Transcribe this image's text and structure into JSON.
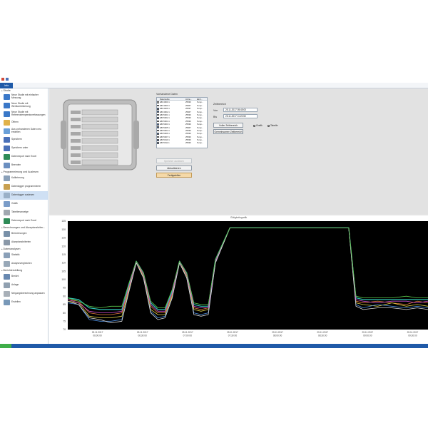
{
  "tab": {
    "label": "Info"
  },
  "sidebar": {
    "sections": [
      {
        "title": "Studie",
        "items": [
          {
            "label": "Neue Studie mit einfacher Messung",
            "icon": "new-study-icon"
          },
          {
            "label": "Neue Studie mit Wertkombinierung",
            "icon": "new-study-icon"
          },
          {
            "label": "Neue Studie mit Referenztemperaturerfassungen",
            "icon": "new-study-icon"
          },
          {
            "label": "Öffnen",
            "icon": "open-folder-icon"
          },
          {
            "label": "Aus vorhandenen Daten neu erstellen",
            "icon": "create-icon"
          },
          {
            "label": "Speichern",
            "icon": "save-icon"
          },
          {
            "label": "Speichern unter",
            "icon": "save-as-icon"
          },
          {
            "label": "Datenexport nach Excel",
            "icon": "excel-icon"
          },
          {
            "label": "Beenden",
            "icon": "exit-icon"
          }
        ]
      },
      {
        "title": "Programmierung und Auslesen",
        "items": [
          {
            "label": "Kalibrierung",
            "icon": "calibration-icon"
          },
          {
            "label": "Datenlogger programmieren",
            "icon": "logger-program-icon"
          },
          {
            "label": "Datenlogger auslesen",
            "icon": "logger-read-icon",
            "selected": true
          }
        ]
      },
      {
        "title": "",
        "items": [
          {
            "label": "Grafik",
            "icon": "graph-icon"
          },
          {
            "label": "Tabellenanzeige",
            "icon": "table-icon"
          },
          {
            "label": "Datenexport nach Excel",
            "icon": "excel-icon"
          }
        ]
      },
      {
        "title": "Berechnungen und Akzeptanzkriter...",
        "items": [
          {
            "label": "Berechnungen",
            "icon": "calc-icon"
          },
          {
            "label": "Akzeptanzkriterien",
            "icon": "criteria-icon"
          }
        ]
      },
      {
        "title": "Datenanalysen",
        "items": [
          {
            "label": "Statistik",
            "icon": "stats-icon"
          },
          {
            "label": "Analysevergleichen",
            "icon": "analysis-icon"
          }
        ]
      },
      {
        "title": "Berichterstellung",
        "items": [
          {
            "label": "Bericht",
            "icon": "report-icon"
          },
          {
            "label": "Anlage",
            "icon": "attachment-icon"
          },
          {
            "label": "Neigungsberechnung anpassen",
            "icon": "slope-icon"
          },
          {
            "label": "Erstellen",
            "icon": "create-report-icon"
          }
        ]
      }
    ]
  },
  "data_panel": {
    "title": "Vorhandene Daten",
    "columns": [
      "Datenreihe",
      "Anza...",
      "Einh..."
    ],
    "rows": [
      {
        "name": "EBI 4600 1",
        "count": "25536",
        "unit": "Temp...",
        "checked": false
      },
      {
        "name": "EBI 4600 1",
        "count": "25667",
        "unit": "Temp...",
        "checked": false
      },
      {
        "name": "EBI 4626 1",
        "count": "25537",
        "unit": "Temp...",
        "checked": true
      },
      {
        "name": "EBI 4602 1",
        "count": "25667",
        "unit": "Temp...",
        "checked": true
      },
      {
        "name": "EBI 5001 1",
        "count": "25530",
        "unit": "Temp...",
        "checked": true
      },
      {
        "name": "EBI 5002 1",
        "count": "25536",
        "unit": "Temp...",
        "checked": true
      },
      {
        "name": "EBI 5004 1",
        "count": "25530",
        "unit": "Temp...",
        "checked": true
      },
      {
        "name": "EBI 5003 1",
        "count": "25536",
        "unit": "Temp...",
        "checked": true
      },
      {
        "name": "EBI 5005 1",
        "count": "25667",
        "unit": "Temp...",
        "checked": true
      },
      {
        "name": "EBI 5004 1",
        "count": "25536",
        "unit": "Temp...",
        "checked": true
      },
      {
        "name": "EBI 5006 1",
        "count": "25536",
        "unit": "Temp...",
        "checked": true
      },
      {
        "name": "EBI 5007 1",
        "count": "25536",
        "unit": "Temp...",
        "checked": true
      },
      {
        "name": "EBI 5010 1",
        "count": "25536",
        "unit": "Temp...",
        "checked": true
      },
      {
        "name": "EBI 5011 1",
        "count": "25536",
        "unit": "Temp...",
        "checked": true
      }
    ]
  },
  "time_panel": {
    "title": "Zeitbereich",
    "from_label": "Von",
    "from_value": "25.11.2017 05:45:00",
    "to_label": "Bis",
    "to_value": "25.11.2017 11:20:50",
    "full_range": "Voller Zeitbereich",
    "common_range": "Gemeinsamer Zeitbereich",
    "radio_graph": "Grafik",
    "radio_table": "Tabelle"
  },
  "buttons": {
    "disabled": "Speicher auslesen",
    "refresh": "Aktualisieren",
    "done": "Fertigstellen"
  },
  "chart_data": {
    "type": "line",
    "title": "Gütigkeitsgrafik",
    "ylim": [
      70,
      135
    ],
    "yticks": [
      70,
      75,
      80,
      85,
      90,
      95,
      100,
      105,
      110,
      115,
      120,
      125,
      130,
      135
    ],
    "xticks": [
      {
        "date": "25.11.2017",
        "time": "06:00:00"
      },
      {
        "date": "25.11.2017",
        "time": "06:30:00"
      },
      {
        "date": "25.11.2017",
        "time": "07:00:00"
      },
      {
        "date": "25.11.2017",
        "time": "07:30:00"
      },
      {
        "date": "25.11.2017",
        "time": "08:00:00"
      },
      {
        "date": "25.11.2017",
        "time": "08:30:00"
      },
      {
        "date": "25.11.2017",
        "time": "09:00:00"
      },
      {
        "date": "25.11.2017",
        "time": "09:30:00"
      }
    ],
    "grid": false,
    "x": [
      0,
      0.03,
      0.06,
      0.09,
      0.12,
      0.15,
      0.17,
      0.19,
      0.21,
      0.23,
      0.25,
      0.27,
      0.29,
      0.31,
      0.33,
      0.35,
      0.37,
      0.39,
      0.41,
      0.45,
      0.48,
      0.52,
      0.56,
      0.6,
      0.64,
      0.68,
      0.72,
      0.76,
      0.78,
      0.8,
      0.82,
      0.86,
      0.9,
      0.94,
      0.97,
      1.0
    ],
    "series": [
      {
        "color": "#2ec2b5",
        "values": [
          89,
          88,
          83,
          82,
          82,
          82,
          97,
          111,
          104,
          86,
          82,
          82,
          93,
          111,
          104,
          85,
          84,
          84,
          112,
          131,
          131,
          131,
          131,
          131,
          131,
          131,
          131,
          131,
          131,
          89,
          88,
          88,
          88,
          88,
          88,
          88
        ]
      },
      {
        "color": "#e07a3a",
        "values": [
          88,
          87,
          80,
          79,
          79,
          80,
          95,
          110,
          103,
          84,
          80,
          80,
          91,
          110,
          103,
          83,
          82,
          83,
          111,
          131,
          131,
          131,
          131,
          131,
          131,
          131,
          131,
          131,
          131,
          87,
          86,
          87,
          86,
          85,
          87,
          86
        ]
      },
      {
        "color": "#e0d046",
        "values": [
          87,
          86,
          78,
          77,
          77,
          78,
          94,
          110,
          102,
          82,
          79,
          79,
          90,
          110,
          102,
          82,
          81,
          82,
          110,
          131,
          131,
          131,
          131,
          131,
          131,
          131,
          131,
          131,
          131,
          86,
          85,
          84,
          86,
          84,
          85,
          84
        ]
      },
      {
        "color": "#4c8de0",
        "values": [
          86,
          85,
          76,
          75,
          75,
          76,
          93,
          110,
          101,
          81,
          77,
          78,
          89,
          110,
          101,
          80,
          79,
          80,
          110,
          131,
          131,
          131,
          131,
          131,
          131,
          131,
          131,
          131,
          131,
          85,
          83,
          85,
          84,
          83,
          84,
          83
        ]
      },
      {
        "color": "#c84bd0",
        "values": [
          88,
          86,
          81,
          80,
          80,
          81,
          96,
          111,
          103,
          85,
          81,
          81,
          92,
          111,
          103,
          84,
          83,
          83,
          111,
          131,
          131,
          131,
          131,
          131,
          131,
          131,
          131,
          131,
          131,
          88,
          87,
          86,
          87,
          87,
          86,
          87
        ]
      },
      {
        "color": "#d8d8d8",
        "values": [
          87,
          85,
          77,
          76,
          74,
          75,
          93,
          110,
          101,
          80,
          76,
          77,
          89,
          110,
          101,
          79,
          78,
          79,
          110,
          131,
          131,
          131,
          131,
          131,
          131,
          131,
          131,
          131,
          131,
          84,
          82,
          83,
          83,
          82,
          83,
          82
        ]
      },
      {
        "color": "#5ac84a",
        "values": [
          89,
          87,
          84,
          83,
          84,
          84,
          98,
          111,
          104,
          87,
          83,
          83,
          94,
          111,
          104,
          86,
          85,
          85,
          112,
          131,
          131,
          131,
          131,
          131,
          131,
          131,
          131,
          131,
          131,
          90,
          89,
          89,
          89,
          90,
          89,
          89
        ]
      }
    ]
  }
}
